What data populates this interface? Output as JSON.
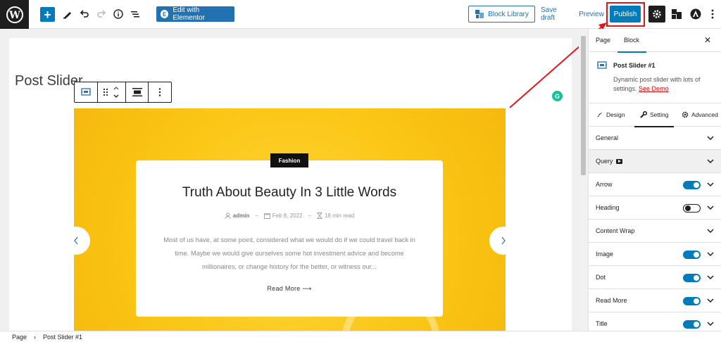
{
  "toolbar": {
    "elementor_label": "Edit with Elementor",
    "block_library_label": "Block Library",
    "save_draft_label": "Save draft",
    "preview_label": "Preview",
    "publish_label": "Publish"
  },
  "editor": {
    "page_title": "Post Slider",
    "slide": {
      "category": "Fashion",
      "title": "Truth About Beauty In 3 Little Words",
      "author": "admin",
      "date": "Feb 8, 2022",
      "read_time": "18 min read",
      "excerpt": "Most of us have, at some point, considered what we would do if we could travel back in time. Maybe we would give ourselves some hot investment advice and become millionaires, or change history for the better, or witness our...",
      "read_more": "Read More"
    }
  },
  "sidebar": {
    "tabs": [
      "Page",
      "Block"
    ],
    "block_name": "Post Slider #1",
    "block_desc": "Dynamic post slider with lots of settings.",
    "see_demo": "See Demo",
    "settings_tabs": [
      "Design",
      "Setting",
      "Advanced"
    ],
    "panels": [
      {
        "label": "General",
        "toggle": null
      },
      {
        "label": "Query",
        "toggle": null
      },
      {
        "label": "Arrow",
        "toggle": true
      },
      {
        "label": "Heading",
        "toggle": false
      },
      {
        "label": "Content Wrap",
        "toggle": null
      },
      {
        "label": "Image",
        "toggle": true
      },
      {
        "label": "Dot",
        "toggle": true
      },
      {
        "label": "Read More",
        "toggle": true
      },
      {
        "label": "Title",
        "toggle": true
      }
    ]
  },
  "footer": {
    "crumbs": [
      "Page",
      "Post Slider #1"
    ]
  },
  "colors": {
    "accent": "#007cba",
    "annotation": "#e3151a",
    "slider_bg": "#fbc716"
  }
}
